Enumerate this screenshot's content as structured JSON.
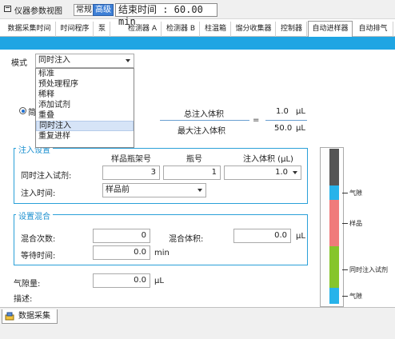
{
  "window": {
    "title": "仪器参数视图"
  },
  "view_modes": [
    "常规",
    "高级"
  ],
  "selected_view_mode": "高级",
  "end_time": "结束时间 : 60.00 min",
  "tabs": [
    "数据采集时间",
    "时间程序",
    "泵",
    "检测器 A",
    "检测器 B",
    "柱温箱",
    "馏分收集器",
    "控制器",
    "自动进样器",
    "自动排气"
  ],
  "active_tab": "自动进样器",
  "mode": {
    "label": "模式",
    "value": "同时注入",
    "options": [
      "标准",
      "预处理程序",
      "稀释",
      "添加试剂",
      "重叠",
      "同时注入",
      "重复进样"
    ],
    "highlighted": "同时注入"
  },
  "radio_partial": "简",
  "injection_volume": {
    "total_label": "总注入体积",
    "total_value": "1.0",
    "total_unit": "μL",
    "max_label": "最大注入体积",
    "max_value": "50.0",
    "max_unit": "μL",
    "equals": "="
  },
  "injection_settings": {
    "title": "注入设置",
    "col_rack": "样品瓶架号",
    "col_vial": "瓶号",
    "col_volume": "注入体积 (μL)",
    "simultaneous_label": "同时注入试剂:",
    "rack_value": "3",
    "vial_value": "1",
    "volume_value": "1.0",
    "timing_label": "注入时间:",
    "timing_value": "样品前"
  },
  "mixing": {
    "title": "设置混合",
    "count_label": "混合次数:",
    "count_value": "0",
    "volume_label": "混合体积:",
    "volume_value": "0.0",
    "volume_unit": "μL",
    "wait_label": "等待时间:",
    "wait_value": "0.0",
    "wait_unit": "min"
  },
  "air_gap": {
    "label": "气隙量:",
    "value": "0.0",
    "unit": "μL"
  },
  "description_label": "描述:",
  "diagram": {
    "labels": [
      "气隙",
      "样品",
      "同时注入试剂",
      "气隙"
    ],
    "colors": {
      "empty": "#555555",
      "air": "#27b3ea",
      "sample": "#f07b7b",
      "reagent": "#86c52b"
    }
  },
  "bottom_tab": {
    "label": "数据采集"
  }
}
